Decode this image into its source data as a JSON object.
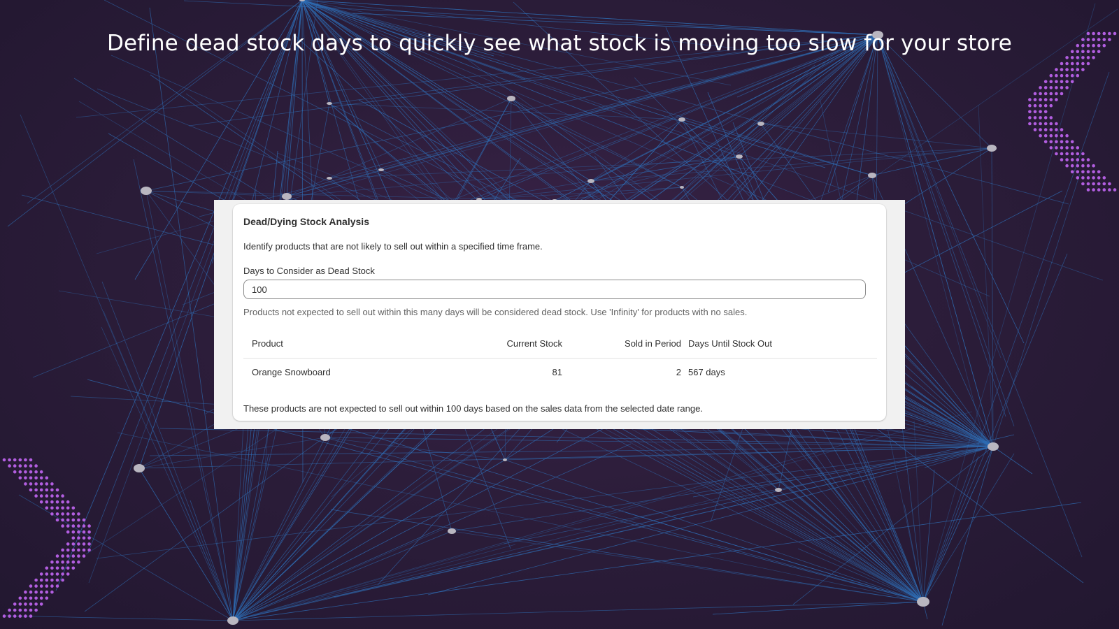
{
  "headline": "Define dead stock days to quickly see what stock is moving too slow for your store",
  "colors": {
    "network_line": "#2f6fb8",
    "network_node": "#b9b6c0",
    "dot_pattern": "#b25ee0",
    "background": "#2c1d3a"
  },
  "card": {
    "title": "Dead/Dying Stock Analysis",
    "description": "Identify products that are not likely to sell out within a specified time frame.",
    "field_label": "Days to Consider as Dead Stock",
    "field_value": "100",
    "help_text": "Products not expected to sell out within this many days will be considered dead stock. Use 'Infinity' for products with no sales.",
    "table": {
      "headers": {
        "product": "Product",
        "current_stock": "Current Stock",
        "sold_in_period": "Sold in Period",
        "days_until_stock_out": "Days Until Stock Out"
      },
      "rows": [
        {
          "product": "Orange Snowboard",
          "current_stock": "81",
          "sold_in_period": "2",
          "days_until_stock_out": "567 days"
        }
      ]
    },
    "footer_text": "These products are not expected to sell out within 100 days based on the sales data from the selected date range."
  }
}
